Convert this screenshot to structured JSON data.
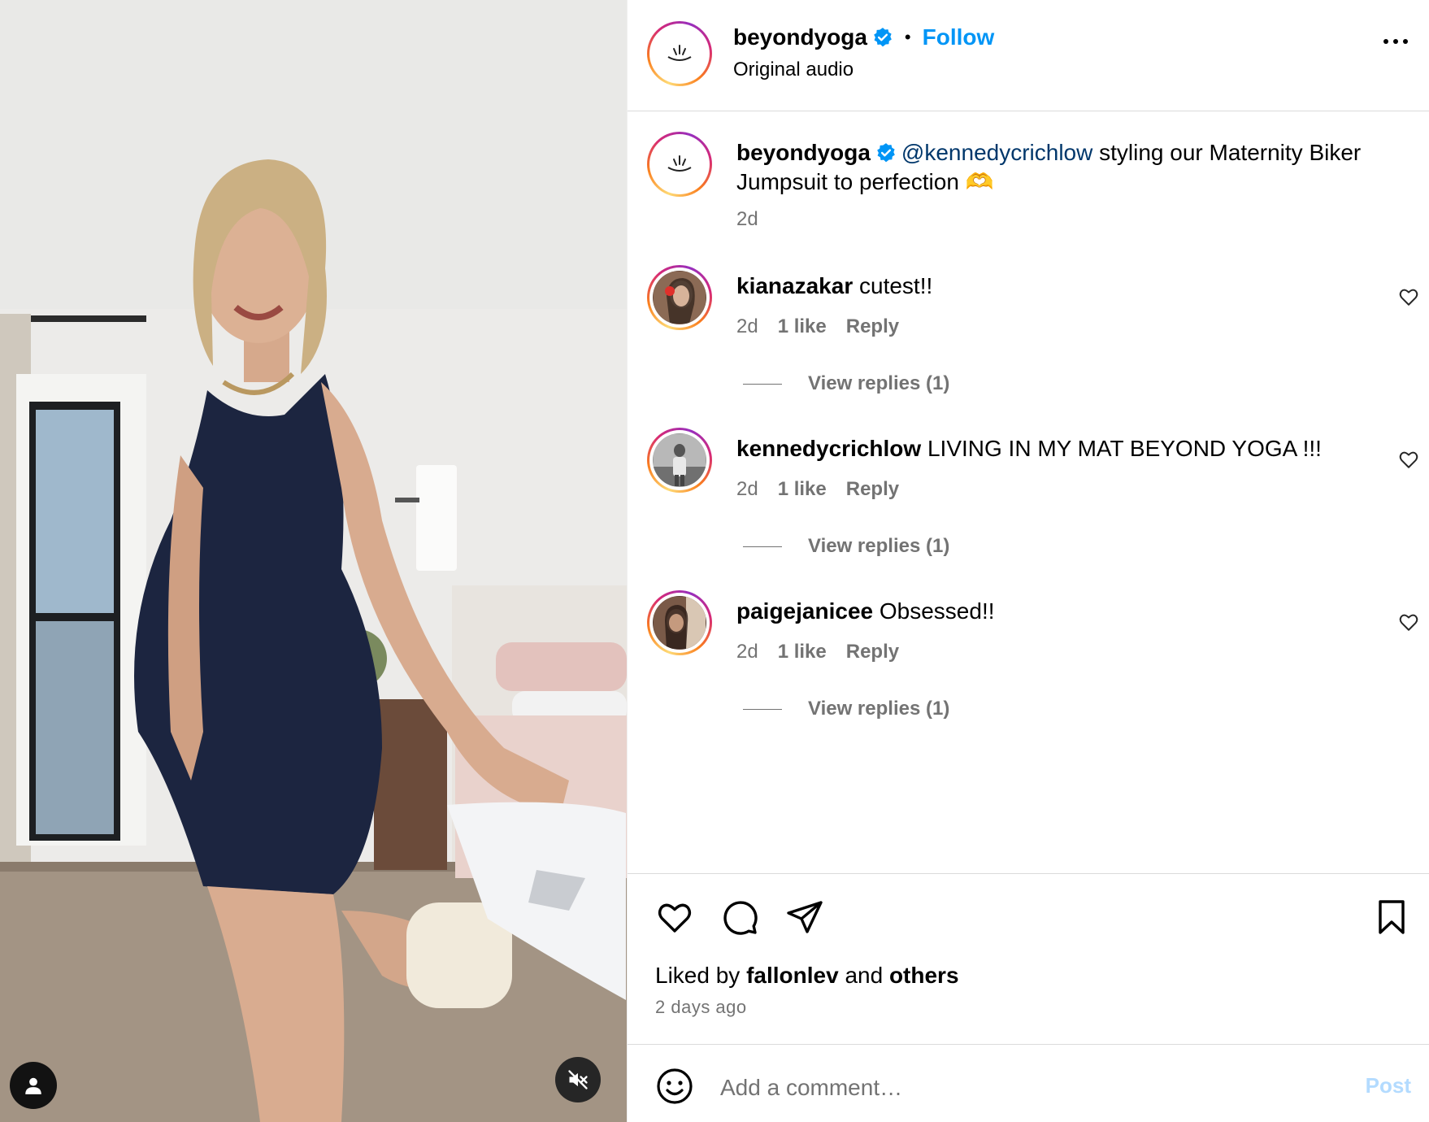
{
  "post": {
    "username": "beyondyoga",
    "follow_label": "Follow",
    "separator": "•",
    "audio_label": "Original audio"
  },
  "caption": {
    "username": "beyondyoga",
    "mention": "@kennedycrichlow",
    "text": " styling our Maternity Biker Jumpsuit to perfection 🫶",
    "time": "2d"
  },
  "comments": [
    {
      "username": "kianazakar",
      "text": "cutest!!",
      "time": "2d",
      "likes": "1 like",
      "reply_label": "Reply",
      "view_replies": "View replies (1)"
    },
    {
      "username": "kennedycrichlow",
      "text": "LIVING IN MY MAT BEYOND YOGA !!!",
      "time": "2d",
      "likes": "1 like",
      "reply_label": "Reply",
      "view_replies": "View replies (1)"
    },
    {
      "username": "paigejanicee",
      "text": "Obsessed!!",
      "time": "2d",
      "likes": "1 like",
      "reply_label": "Reply",
      "view_replies": "View replies (1)"
    }
  ],
  "likes": {
    "prefix": "Liked by",
    "user": "fallonlev",
    "and": "and",
    "others": "others"
  },
  "time_ago": "2 days ago",
  "composer": {
    "placeholder": "Add a comment…",
    "post_label": "Post"
  },
  "colors": {
    "follow": "#0095f6",
    "verified": "#0095f6",
    "mention": "#00376b",
    "muted_text": "#737373",
    "post_disabled": "#b3dbff"
  },
  "icons": [
    "more-options-icon",
    "verified-badge-icon",
    "heart-icon",
    "comment-icon",
    "share-icon",
    "bookmark-icon",
    "emoji-icon",
    "user-tag-icon",
    "mute-icon"
  ]
}
